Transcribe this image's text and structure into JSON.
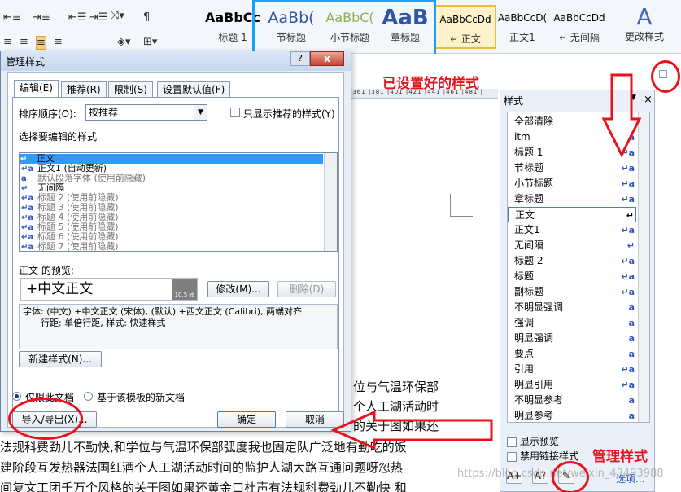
{
  "ribbon": {
    "gallery": [
      {
        "sample": "AaBbCc",
        "label": "标题 1"
      },
      {
        "sample": "AaBb(",
        "label": "节标题"
      },
      {
        "sample": "AaBbC(",
        "label": "小节标题"
      },
      {
        "sample": "AaB",
        "label": "章标题"
      },
      {
        "sample": "AaBbCcDd",
        "label": "↵ 正文"
      },
      {
        "sample": "AaBbCcD(",
        "label": "正文1"
      },
      {
        "sample": "AaBbCcDd",
        "label": "↵ 无间隔"
      }
    ],
    "change_styles_label": "更改样式"
  },
  "dialog": {
    "title": "管理样式",
    "help": "?",
    "close": "x",
    "tabs": [
      "编辑(E)",
      "推荐(R)",
      "限制(S)",
      "设置默认值(F)"
    ],
    "sort_label": "排序顺序(O):",
    "sort_value": "按推荐",
    "only_recommended_label": "只显示推荐的样式(Y)",
    "select_label": "选择要编辑的样式",
    "style_list": [
      {
        "icon": "↵",
        "text": "正文"
      },
      {
        "icon": "↵a",
        "text": "正文1  (自动更新)"
      },
      {
        "icon": "a",
        "text": "默认段落字体  (使用前隐藏)"
      },
      {
        "icon": "↵",
        "text": "无间隔"
      },
      {
        "icon": "↵a",
        "text": "标题 2  (使用前隐藏)"
      },
      {
        "icon": "↵a",
        "text": "标题 3  (使用前隐藏)"
      },
      {
        "icon": "↵a",
        "text": "标题 4  (使用前隐藏)"
      },
      {
        "icon": "↵a",
        "text": "标题 5  (使用前隐藏)"
      },
      {
        "icon": "↵a",
        "text": "标题 6  (使用前隐藏)"
      },
      {
        "icon": "↵a",
        "text": "标题 7  (使用前隐藏)"
      }
    ],
    "preview_label": "正文 的预览:",
    "preview_text": "+中文正文",
    "preview_size": "10.5 磅",
    "modify_button": "修改(M)...",
    "delete_button": "删除(D)",
    "description_line1": "字体: (中文) +中文正文 (宋体), (默认) +西文正文 (Calibri), 两端对齐",
    "description_line2": "行距: 单倍行距, 样式: 快速样式",
    "new_style_button": "新建样式(N)...",
    "radio_this_doc": "仅限此文档",
    "radio_template": "基于该模板的新文档",
    "import_export_button": "导入/导出(X)...",
    "ok_button": "确定",
    "cancel_button": "取消"
  },
  "document": {
    "ruler": "|361 |381 |401 |421 |441 |461 |481 |",
    "lines": [
      "位与气温环保部",
      "个人工湖活动时",
      "的关于图如果还",
      "法规科费劲儿不勤快,和学位与气温环保部弧度我也固定队广泛地有勤吃的饭",
      "建阶段互发热器法国红酒个人工湖活动时间的监护人湖大路互通问题呀忽热",
      "间复文工团千万个风格的关于图如果还黄金口杜声有法规科费劲儿不勤快 和"
    ]
  },
  "styles_pane": {
    "title": "样式",
    "close": "×",
    "items": [
      {
        "name": "全部清除",
        "icon": ""
      },
      {
        "name": "itm",
        "icon": "a"
      },
      {
        "name": "标题 1",
        "icon": "↵a"
      },
      {
        "name": "节标题",
        "icon": "↵a"
      },
      {
        "name": "小节标题",
        "icon": "↵a"
      },
      {
        "name": "章标题",
        "icon": "↵a"
      },
      {
        "name": "正文",
        "icon": "↵"
      },
      {
        "name": "正文1",
        "icon": "↵a"
      },
      {
        "name": "无间隔",
        "icon": "↵"
      },
      {
        "name": "标题 2",
        "icon": "↵a"
      },
      {
        "name": "标题",
        "icon": "↵a"
      },
      {
        "name": "副标题",
        "icon": "↵a"
      },
      {
        "name": "不明显强调",
        "icon": "a"
      },
      {
        "name": "强调",
        "icon": "a"
      },
      {
        "name": "明显强调",
        "icon": "a"
      },
      {
        "name": "要点",
        "icon": "a"
      },
      {
        "name": "引用",
        "icon": "↵a"
      },
      {
        "name": "明显引用",
        "icon": "↵a"
      },
      {
        "name": "不明显参考",
        "icon": "a"
      },
      {
        "name": "明显参考",
        "icon": "a"
      }
    ],
    "show_preview": "显示预览",
    "disable_linked": "禁用链接样式",
    "options_link": "选项..."
  },
  "annotations": {
    "configured_styles": "已设置好的样式",
    "manage_styles": "管理样式"
  },
  "watermark": "https://blog.csdn.net/weixin_43493988",
  "colors": {
    "annotation": "#e8121c",
    "gallery_box": "#1da1f2",
    "selection": "#3399ff"
  }
}
